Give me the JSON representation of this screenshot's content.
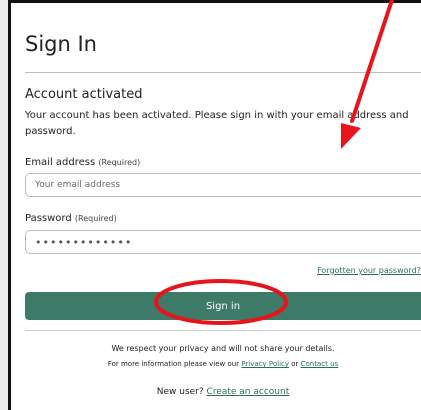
{
  "form": {
    "title": "Sign In",
    "notice_heading": "Account activated",
    "notice_body": "Your account has been activated. Please sign in with your email address and password.",
    "email_label": "Email address",
    "email_required": "(Required)",
    "email_placeholder": "Your email address",
    "password_label": "Password",
    "password_required": "(Required)",
    "password_value": "•••••••••••••",
    "forgot_link": "Forgotten your password?",
    "submit_label": "Sign in"
  },
  "footer": {
    "privacy_line": "We respect your privacy and will not share your details.",
    "info_prefix": "For more information please view our ",
    "privacy_link": "Privacy Policy",
    "info_or": " or ",
    "contact_link": "Contact us",
    "new_user_prefix": "New user? ",
    "create_account_link": "Create an account"
  },
  "annotation": {
    "color": "#e8141c",
    "arrow": "red-arrow",
    "circle": "red-ellipse"
  }
}
